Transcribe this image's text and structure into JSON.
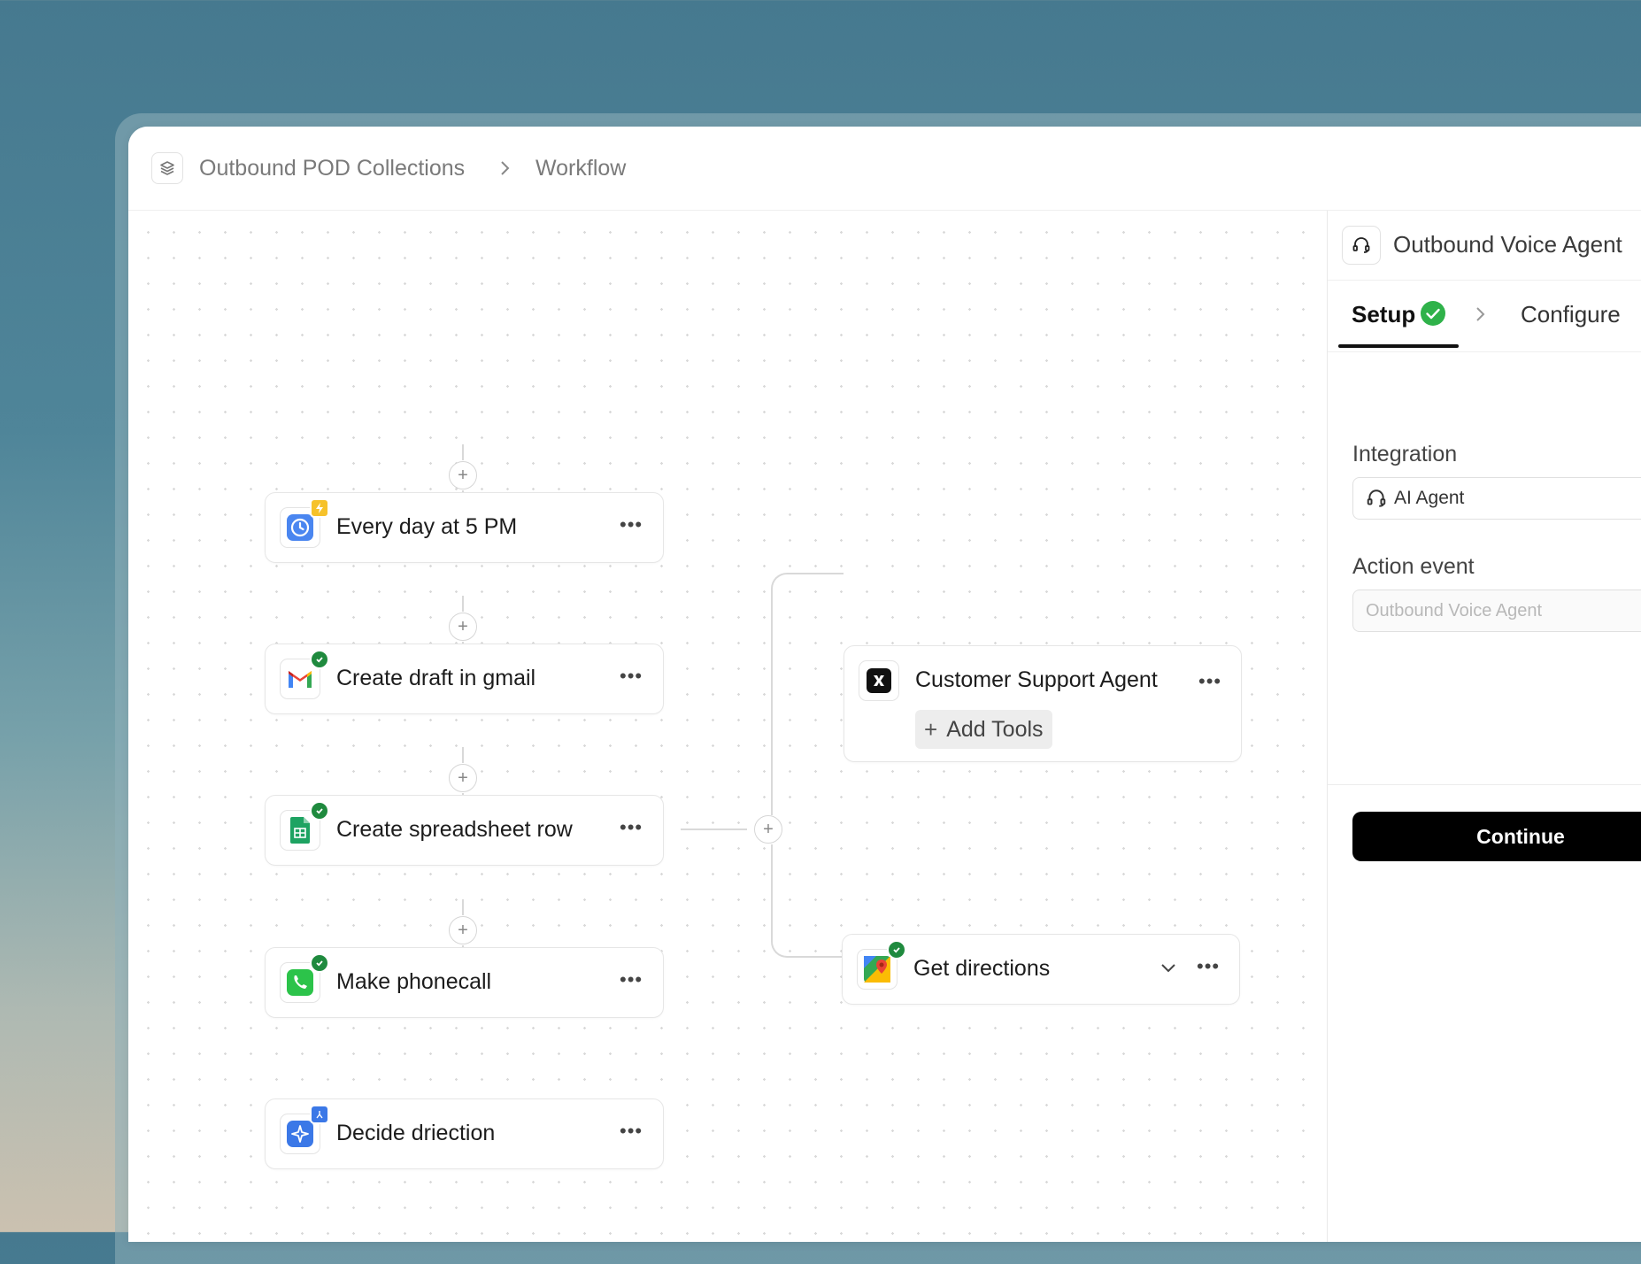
{
  "breadcrumb": {
    "project": "Outbound POD Collections",
    "page": "Workflow"
  },
  "workflow": {
    "steps": [
      {
        "label": "Every day at 5 PM",
        "icon": "clock-icon"
      },
      {
        "label": "Create draft in gmail",
        "icon": "gmail-icon"
      },
      {
        "label": "Create spreadsheet row",
        "icon": "sheets-icon"
      },
      {
        "label": "Make phonecall",
        "icon": "phone-icon"
      },
      {
        "label": "Decide driection",
        "icon": "sparkle-icon"
      }
    ],
    "branches": [
      {
        "label": "Customer Support Agent",
        "icon": "agent-logo-icon",
        "add_tools": "Add Tools"
      },
      {
        "label": "Get directions",
        "icon": "maps-icon"
      }
    ]
  },
  "panel": {
    "title": "Outbound Voice Agent",
    "tabs": {
      "setup": "Setup",
      "configure": "Configure"
    },
    "integration_label": "Integration",
    "integration_value": "AI Agent",
    "action_event_label": "Action event",
    "action_event_placeholder": "Outbound Voice Agent",
    "continue_label": "Continue"
  },
  "colors": {
    "accent_green": "#2fb24a",
    "badge_green": "#1f8a3e",
    "badge_yellow": "#f6c22b",
    "badge_blue": "#3b78e7"
  }
}
